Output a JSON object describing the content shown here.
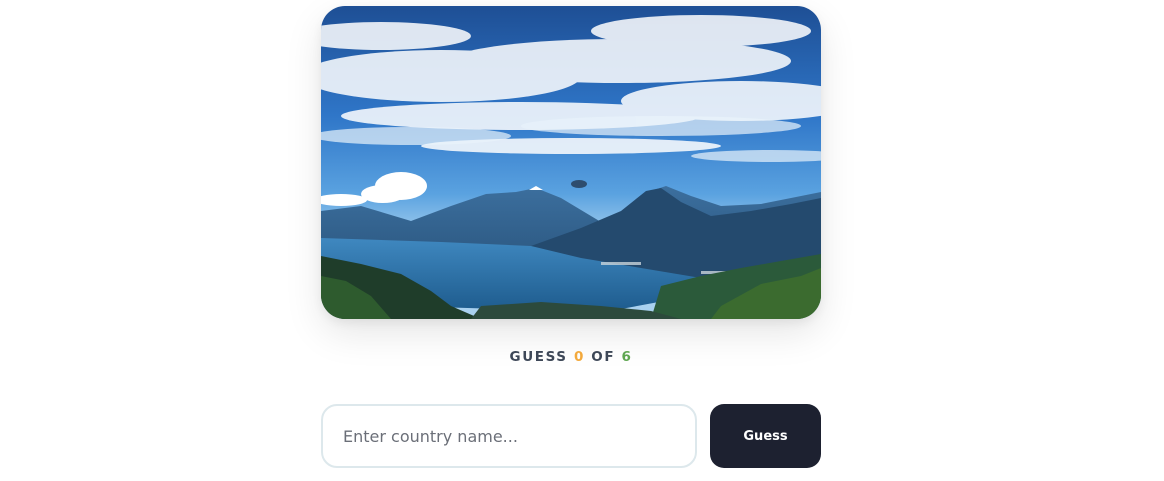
{
  "game": {
    "photo": {
      "subject": "lake-volcano-landscape"
    },
    "counter": {
      "prefix": "GUESS",
      "current": "0",
      "separator": "OF",
      "max": "6"
    },
    "form": {
      "input_placeholder": "Enter country name...",
      "input_value": "",
      "button_label": "Guess"
    }
  },
  "colors": {
    "counter_text": "#3d4757",
    "counter_current": "#f3a93c",
    "counter_max": "#5fa651",
    "button_bg": "#1d2130",
    "input_border": "#dde8ec"
  }
}
